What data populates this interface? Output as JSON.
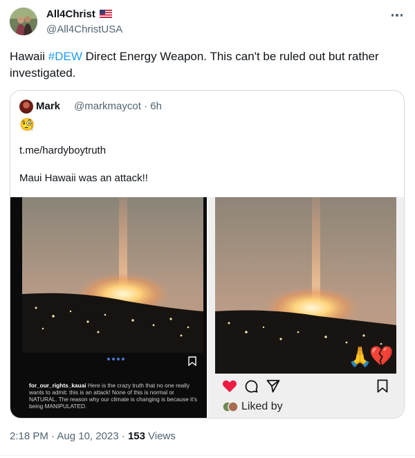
{
  "author": {
    "display_name": "All4Christ",
    "handle": "@All4ChristUSA"
  },
  "tweet": {
    "text_before": "Hawaii ",
    "hashtag": "#DEW",
    "text_after": " Direct Energy Weapon. This can't be ruled out but rather investigated."
  },
  "quote": {
    "display_name": "Mark",
    "handle_time": "@markmaycot · 6h",
    "emoji": "🧐",
    "line1": "t.me/hardyboytruth",
    "line2": "Maui Hawaii was an attack!!",
    "left_panel": {
      "caption_user": "for_our_rights_kauai",
      "caption_text": " Here is the crazy truth that no one really wants to admit: this is an attack! None of this is normal or NATURAL. The reason why our climate is changing is because it's being MANIPULATED."
    },
    "right_panel": {
      "emoji_pray": "🙏",
      "emoji_heart": "💔",
      "liked_text": "Liked by"
    }
  },
  "footer": {
    "time_date": "2:18 PM · Aug 10, 2023 · ",
    "views_count": "153",
    "views_label": " Views"
  },
  "colors": {
    "accent": "#1d9bf0",
    "secondary_text": "#536471",
    "border": "#cfd9de",
    "ig_heart": "#ed1b42"
  },
  "icons": [
    "flag-icon",
    "more-icon",
    "save-icon",
    "heart-icon",
    "comment-icon",
    "share-icon",
    "bookmark-icon"
  ]
}
